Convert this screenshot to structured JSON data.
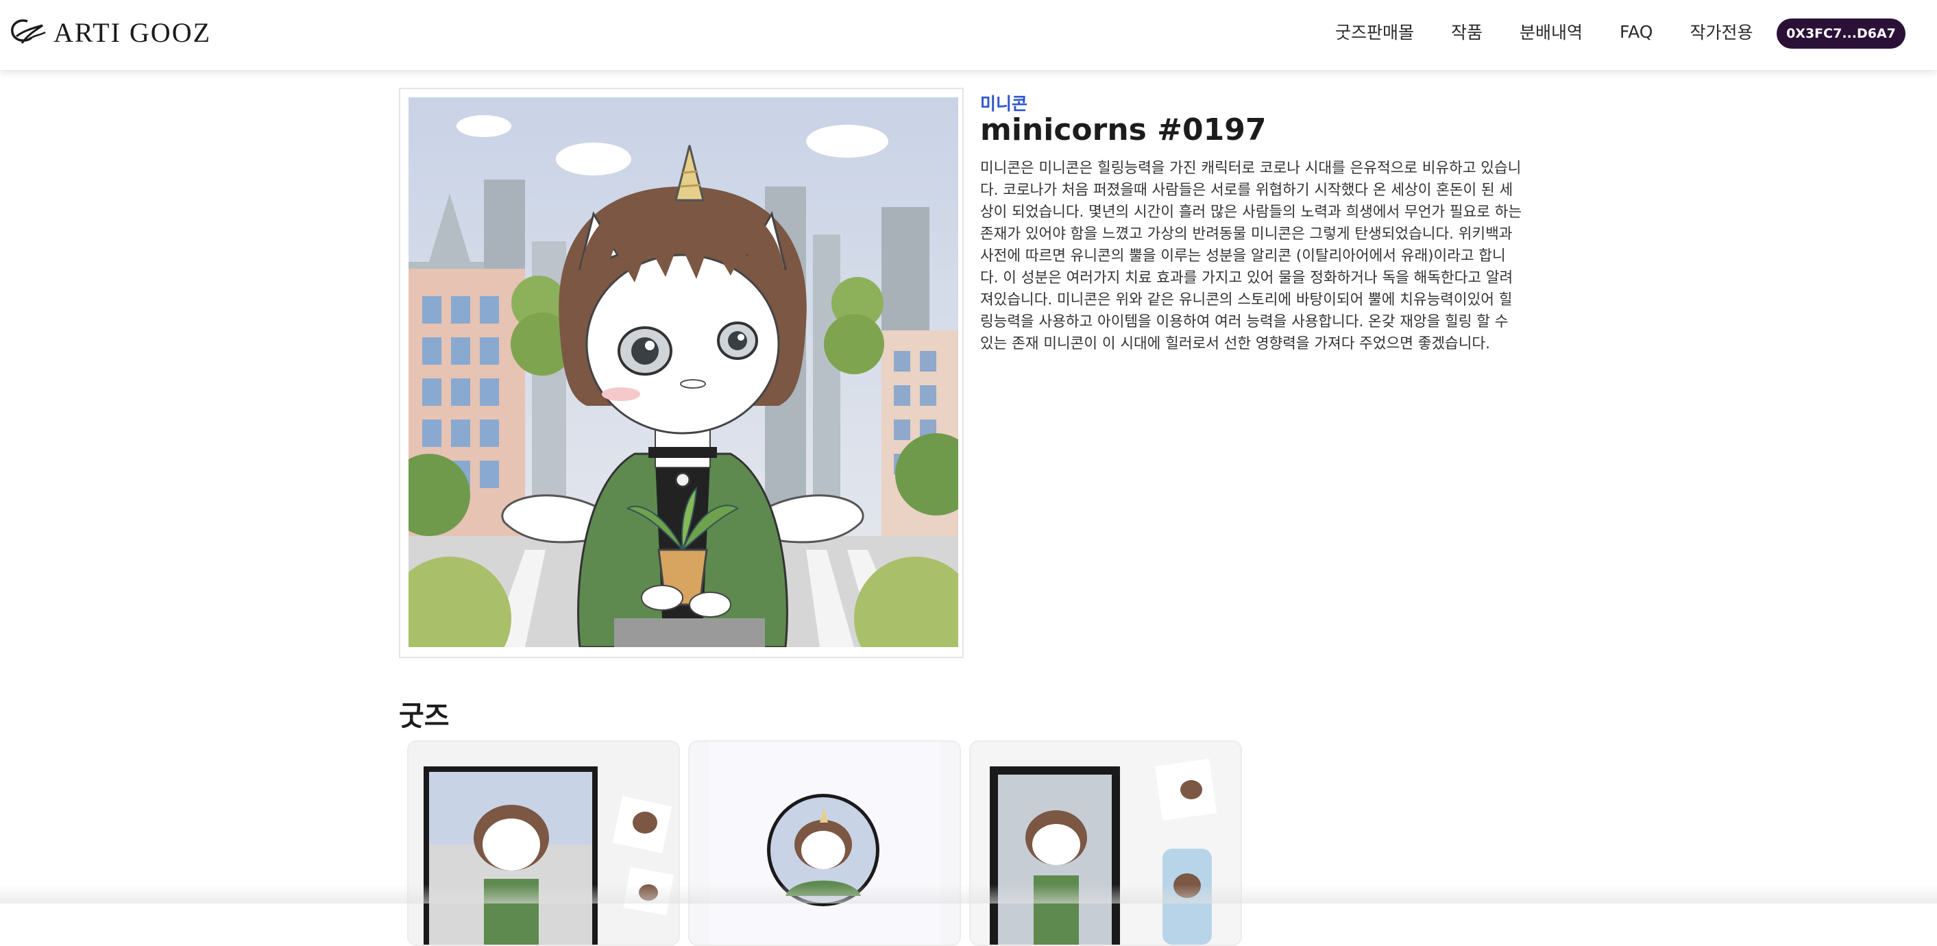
{
  "header": {
    "logo_text": "ARTI GOOZ",
    "nav": [
      "굿즈판매몰",
      "작품",
      "분배내역",
      "FAQ",
      "작가전용"
    ],
    "wallet_address": "0X3FC7...D6A7"
  },
  "artwork": {
    "image": "minicorn-character-illustration",
    "collection": "미니콘",
    "title": "minicorns #0197",
    "description": "미니콘은 미니콘은 힐링능력을 가진 캐릭터로 코로나 시대를 은유적으로 비유하고 있습니다. 코로나가 처음 퍼졌을때 사람들은 서로를 위협하기 시작했다 온 세상이 혼돈이 된 세상이 되었습니다. 몇년의 시간이 흘러 많은 사람들의 노력과 희생에서 무언가 필요로 하는 존재가 있어야 함을 느꼈고 가상의 반려동물 미니콘은 그렇게 탄생되었습니다. 위키백과 사전에 따르면 유니콘의 뿔을 이루는 성분을 알리콘 (이탈리아어에서 유래)이라고 합니다. 이 성분은 여러가지 치료 효과를 가지고 있어 물을 정화하거나 독을 해독한다고 알려져있습니다. 미니콘은 위와 같은 유니콘의 스토리에 바탕이되어 뿔에 치유능력이있어 힐링능력을 사용하고 아이템을 이용하여 여러 능력을 사용합니다. 온갖 재앙을 힐링 할 수 있는 존재 미니콘이 이 시대에 힐러로서 선한 영향력을 가져다 주었으면 좋겠습니다."
  },
  "goods": {
    "heading": "굿즈",
    "items": [
      {
        "name": "framed-print-goods"
      },
      {
        "name": "round-badge-goods"
      },
      {
        "name": "frame-and-phonecase-goods"
      }
    ]
  },
  "colors": {
    "accent_link": "#2e57c9",
    "wallet_bg": "#2b1137",
    "jacket_green": "#5e8a4f"
  }
}
